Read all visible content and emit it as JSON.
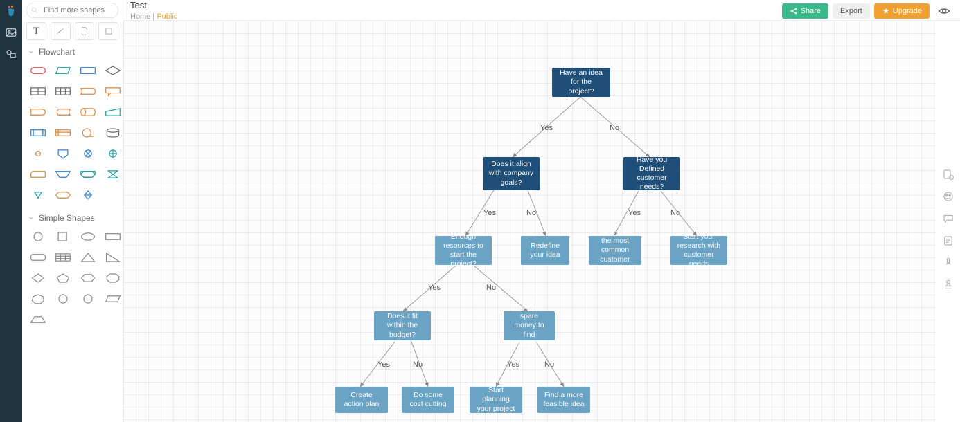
{
  "header": {
    "doc_title": "Test",
    "breadcrumb_home": "Home",
    "breadcrumb_public": "Public",
    "share_label": "Share",
    "export_label": "Export",
    "upgrade_label": "Upgrade"
  },
  "search": {
    "placeholder": "Find more shapes"
  },
  "sections": {
    "flowchart_label": "Flowchart",
    "simple_shapes_label": "Simple Shapes"
  },
  "flow": {
    "nodes": {
      "root": "Have an idea for the project?",
      "align": "Does it align with company goals?",
      "needs": "Have you Defined customer needs?",
      "resources": "Enough resources to start the project?",
      "redefine": "Redefine your idea",
      "start_common": "Start with the most common customer need",
      "start_research": "Start your research with customer needs",
      "budget": "Does it fit within the budget?",
      "spare": "Can you spare money to find resources?",
      "action_plan": "Create action plan",
      "cost_cut": "Do some cost cutting",
      "start_plan": "Start planning your project",
      "feasible": "Find a more feasible idea"
    },
    "labels": {
      "yes": "Yes",
      "no": "No"
    }
  },
  "chart_data": {
    "type": "flowchart",
    "nodes": [
      {
        "id": "root",
        "text": "Have an idea for the project?",
        "style": "dark"
      },
      {
        "id": "align",
        "text": "Does it align with company goals?",
        "style": "dark"
      },
      {
        "id": "needs",
        "text": "Have you Defined customer needs?",
        "style": "dark"
      },
      {
        "id": "resources",
        "text": "Enough resources to start the project?",
        "style": "light"
      },
      {
        "id": "redefine",
        "text": "Redefine your idea",
        "style": "light"
      },
      {
        "id": "start_common",
        "text": "Start with the most common customer need",
        "style": "light"
      },
      {
        "id": "start_research",
        "text": "Start your research with customer needs",
        "style": "light"
      },
      {
        "id": "budget",
        "text": "Does it fit within the budget?",
        "style": "light"
      },
      {
        "id": "spare",
        "text": "Can you spare money to find resources?",
        "style": "light"
      },
      {
        "id": "action_plan",
        "text": "Create action plan",
        "style": "light"
      },
      {
        "id": "cost_cut",
        "text": "Do some cost cutting",
        "style": "light"
      },
      {
        "id": "start_plan",
        "text": "Start planning your project",
        "style": "light"
      },
      {
        "id": "feasible",
        "text": "Find a more feasible idea",
        "style": "light"
      }
    ],
    "edges": [
      {
        "from": "root",
        "to": "align",
        "label": "Yes"
      },
      {
        "from": "root",
        "to": "needs",
        "label": "No"
      },
      {
        "from": "align",
        "to": "resources",
        "label": "Yes"
      },
      {
        "from": "align",
        "to": "redefine",
        "label": "No"
      },
      {
        "from": "needs",
        "to": "start_common",
        "label": "Yes"
      },
      {
        "from": "needs",
        "to": "start_research",
        "label": "No"
      },
      {
        "from": "resources",
        "to": "budget",
        "label": "Yes"
      },
      {
        "from": "resources",
        "to": "spare",
        "label": "No"
      },
      {
        "from": "budget",
        "to": "action_plan",
        "label": "Yes"
      },
      {
        "from": "budget",
        "to": "cost_cut",
        "label": "No"
      },
      {
        "from": "spare",
        "to": "start_plan",
        "label": "Yes"
      },
      {
        "from": "spare",
        "to": "feasible",
        "label": "No"
      }
    ]
  }
}
